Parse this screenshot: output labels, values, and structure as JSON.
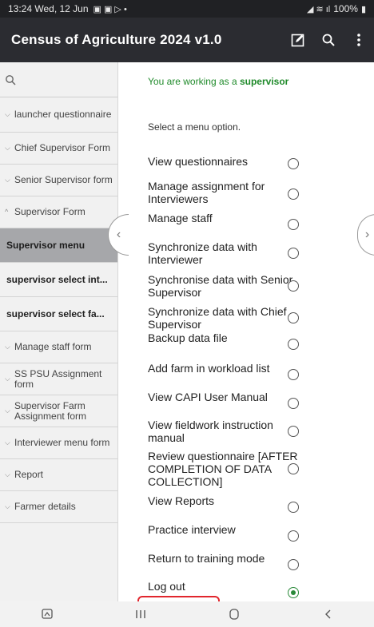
{
  "status_bar": {
    "time_date": "13:24  Wed, 12 Jun",
    "battery": "100%"
  },
  "app_bar": {
    "title": "Census of Agriculture 2024 v1.0",
    "icons": [
      "edit-icon",
      "search-icon",
      "overflow-menu-icon"
    ]
  },
  "sidebar": {
    "items": [
      {
        "label": "launcher questionnaire",
        "state": "collapsed"
      },
      {
        "label": "Chief Supervisor Form",
        "state": "collapsed"
      },
      {
        "label": "Senior Supervisor form",
        "state": "collapsed"
      },
      {
        "label": "Supervisor Form",
        "state": "expanded"
      },
      {
        "label": "Supervisor menu",
        "state": "selected"
      },
      {
        "label": "supervisor select int...",
        "state": "sub"
      },
      {
        "label": "supervisor select fa...",
        "state": "sub"
      },
      {
        "label": "Manage staff form",
        "state": "collapsed"
      },
      {
        "label": "SS PSU Assignment form",
        "state": "collapsed"
      },
      {
        "label": "Supervisor Farm Assignment form",
        "state": "collapsed"
      },
      {
        "label": "Interviewer menu form",
        "state": "collapsed"
      },
      {
        "label": "Report",
        "state": "collapsed"
      },
      {
        "label": "Farmer details",
        "state": "collapsed"
      }
    ]
  },
  "main": {
    "notice_prefix": "You are working as a ",
    "notice_role": "supervisor",
    "prompt": "Select a menu option.",
    "options": [
      {
        "label": "View questionnaires",
        "checked": false
      },
      {
        "label": "Manage assignment for Interviewers",
        "checked": false
      },
      {
        "label": "Manage staff",
        "checked": false
      },
      {
        "label": "Synchronize data with Interviewer",
        "checked": false
      },
      {
        "label": "Synchronise data with Senior Supervisor",
        "checked": false
      },
      {
        "label": "Synchronize data with Chief Supervisor",
        "checked": false
      },
      {
        "label": "Backup data file",
        "checked": false
      },
      {
        "label": "Add farm in workload list",
        "checked": false
      },
      {
        "label": "View CAPI User Manual",
        "checked": false
      },
      {
        "label": "View fieldwork instruction manual",
        "checked": false
      },
      {
        "label": "Review questionnaire [AFTER COMPLETION OF DATA COLLECTION]",
        "checked": false
      },
      {
        "label": "View Reports",
        "checked": false
      },
      {
        "label": "Practice interview",
        "checked": false
      },
      {
        "label": "Return to training mode",
        "checked": false
      },
      {
        "label": "Log out",
        "checked": true
      }
    ]
  },
  "colors": {
    "app_bar": "#2b2c31",
    "notice_green": "#1f8a2a",
    "selected_radio": "#2a8a3a",
    "highlight_red": "#e1262d",
    "selected_sidebar": "#a6a7aa"
  }
}
